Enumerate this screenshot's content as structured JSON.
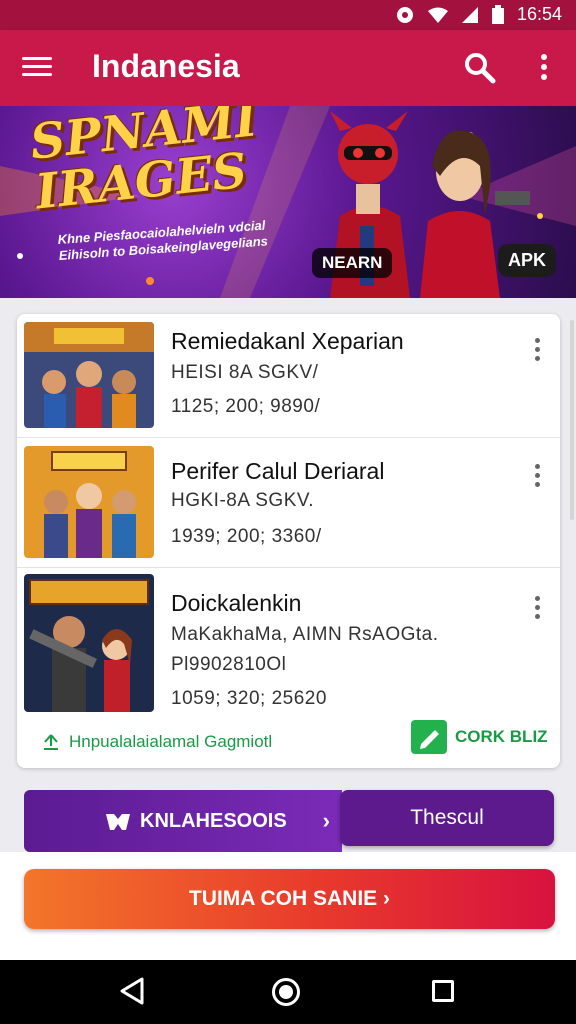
{
  "status_bar": {
    "time": "16:54"
  },
  "app_bar": {
    "title": "Indanesia"
  },
  "banner": {
    "title_line1": "SPNAMI",
    "title_line2": "IRAGES",
    "subtitle": "Khne Piesfaocaiolahelvieln vdcial Eihisoln to Boisakeinglavegelians",
    "badge_left": "NEARN",
    "badge_right": "APK"
  },
  "list": {
    "items": [
      {
        "title": "Remiedakanl Xeparian",
        "line1": "HEISI 8A SGKV/",
        "line2": "1125; 200; 9890/"
      },
      {
        "title": "Perifer Calul Deriaral",
        "line1": "HGKI-8A SGKV.",
        "line2": "1939; 200; 3360/"
      },
      {
        "title": "Doickalenkin",
        "line1": "MaKakhaMa, AIMN RsAOGta.",
        "line2": "Pl9902810Ol",
        "line3": "1059; 320; 25620"
      }
    ],
    "footer_left": "Hnpualalaialamal Gagmiotl",
    "footer_right": "CORK BLIZ"
  },
  "purple_bar": {
    "left_label": "KNLAHESOOIS",
    "right_label": "Thescul"
  },
  "cta": {
    "label": "TUIMA COH SANIE ›"
  },
  "colors": {
    "primary": "#c9184a",
    "status": "#a3123f",
    "accent_green": "#22b14c",
    "purple": "#5c1a8c"
  }
}
